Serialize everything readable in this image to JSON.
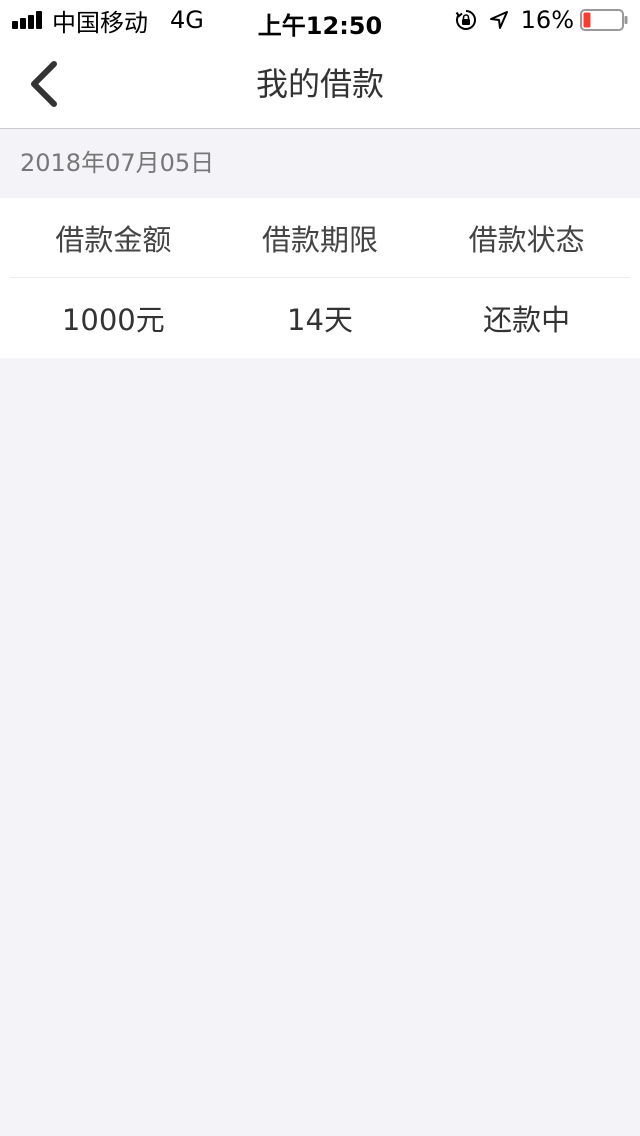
{
  "status_bar": {
    "carrier": "中国移动",
    "network": "4G",
    "time": "上午12:50",
    "battery": "16%",
    "colors": {
      "battery_low": "#ff3b30"
    }
  },
  "nav": {
    "title": "我的借款",
    "back_icon": "chevron-left-icon"
  },
  "loan": {
    "date": "2018年07月05日",
    "headers": [
      "借款金额",
      "借款期限",
      "借款状态"
    ],
    "values": [
      "1000元",
      "14天",
      "还款中"
    ]
  }
}
